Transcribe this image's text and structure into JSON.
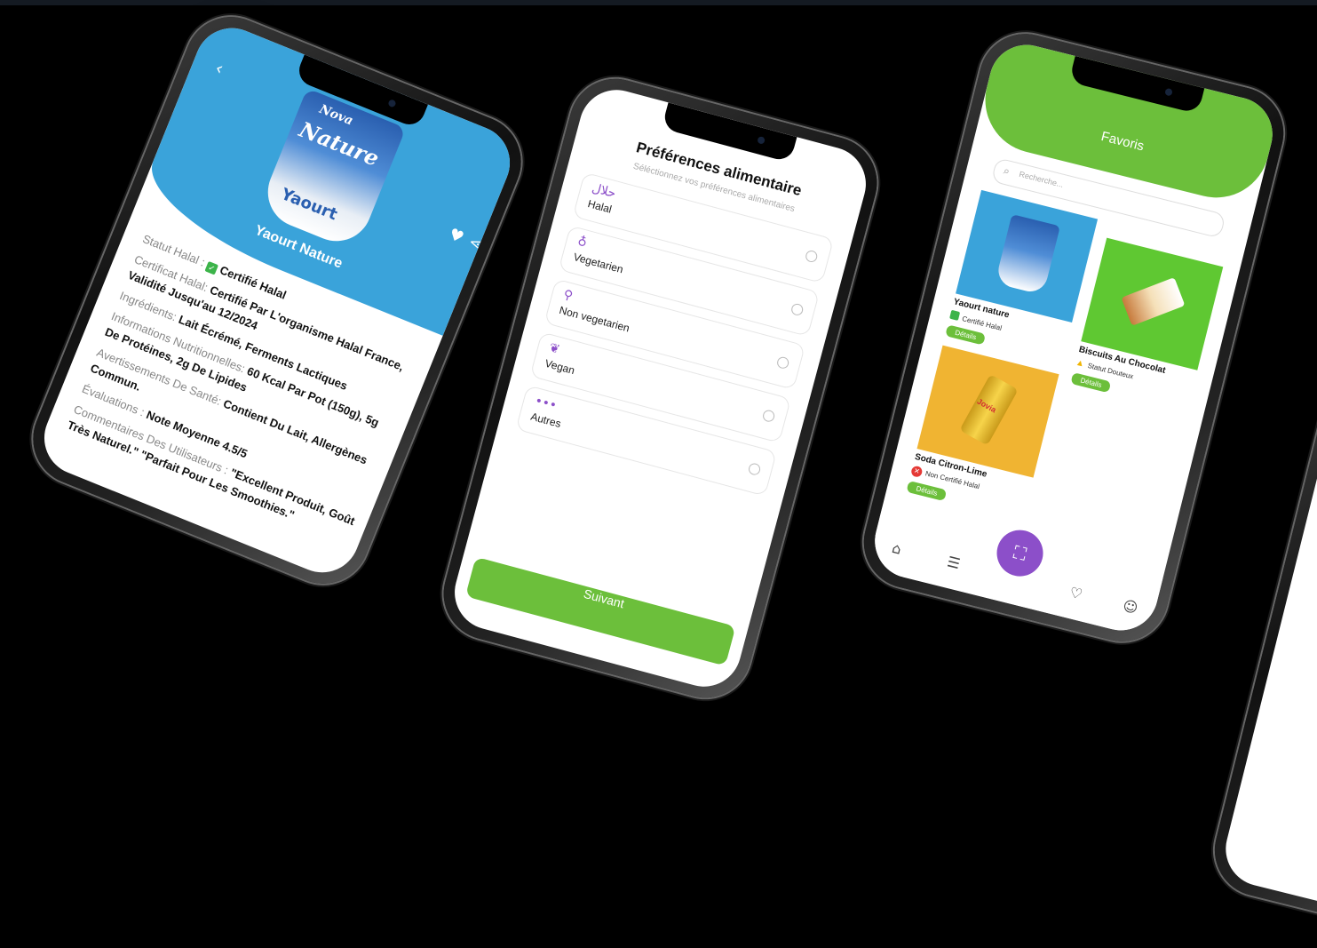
{
  "product_detail": {
    "brand": "Nova",
    "pack_title": "Nature",
    "pack_sub": "Yaourt",
    "title": "Yaourt Nature",
    "rows": [
      {
        "key": "Statut Halal :",
        "value": "Certifié Halal",
        "badge": true
      },
      {
        "key": "Certificat Halal:",
        "value": "Certifié Par L'organisme Halal France, Validité Jusqu'au 12/2024",
        "badge": false
      },
      {
        "key": "Ingrédients:",
        "value": "Lait Écrémé, Ferments Lactiques",
        "badge": false
      },
      {
        "key": "Informations Nutritionnelles:",
        "value": "60 Kcal Par Pot (150g), 5g De Protéines, 2g De Lipides",
        "badge": false
      },
      {
        "key": "Avertissements De Santé:",
        "value": "Contient Du Lait, Allergènes Commun.",
        "badge": false
      },
      {
        "key": "Évaluations :",
        "value": "Note Moyenne 4.5/5",
        "badge": false
      },
      {
        "key": "Commentaires Des Utilisateurs :",
        "value": "\"Excellent Produit, Goût Très Naturel.\" \"Parfait Pour Les Smoothies.\"",
        "badge": false
      }
    ]
  },
  "preferences": {
    "title": "Préférences alimentaire",
    "subtitle": "Séléctionnez vos préférences alimentaires",
    "options": [
      {
        "icon": "حلال",
        "label": "Halal"
      },
      {
        "icon": "♁",
        "label": "Vegetarien"
      },
      {
        "icon": "⚲",
        "label": "Non vegetarien"
      },
      {
        "icon": "❦",
        "label": "Vegan"
      },
      {
        "icon": "•••",
        "label": "Autres"
      }
    ],
    "next_label": "Suivant"
  },
  "favorites": {
    "title": "Favoris",
    "search_placeholder": "Recherche...",
    "items": [
      {
        "name": "Yaourt nature",
        "status": "Certifié Halal",
        "status_type": "ok",
        "details": "Détails",
        "bg": "#3aa3da"
      },
      {
        "name": "Biscuits Au Chocolat",
        "status": "Statut Douteux",
        "status_type": "warn",
        "details": "Détails",
        "bg": "#5fc832"
      },
      {
        "name": "Soda Citron-Lime",
        "status": "Non Certifié Halal",
        "status_type": "no",
        "details": "Détails",
        "bg": "#f0b432"
      }
    ],
    "can_label": "Jovia"
  },
  "colors": {
    "blue": "#3aa3da",
    "green": "#6cbf3b",
    "purple": "#8c4fc9"
  }
}
